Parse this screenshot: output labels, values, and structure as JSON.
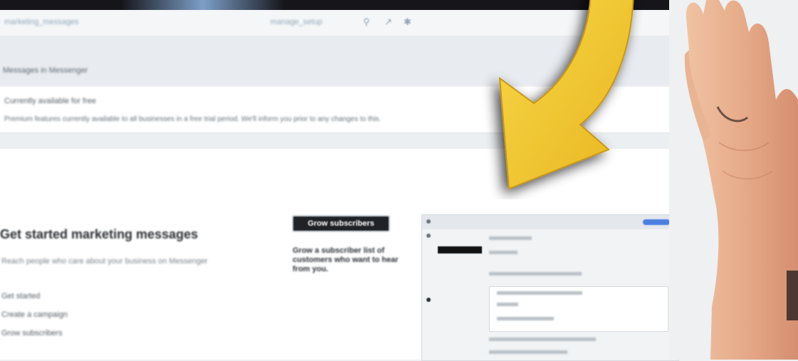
{
  "browser": {
    "address_text": "marketing_messages",
    "address_text_right": "manage_setup"
  },
  "page_header": {
    "title": "Messages in Messenger"
  },
  "notice": {
    "title": "Currently available for free",
    "body": "Premium features currently available to all businesses in a free trial period. We'll inform you prior to any changes to this."
  },
  "main": {
    "heading": "Get started marketing messages",
    "subtext": "Reach people who care about your business on Messenger",
    "list": [
      "Get started",
      "Create a campaign",
      "Grow subscribers"
    ]
  },
  "grow": {
    "button_label": "Grow subscribers",
    "description": "Grow a subscriber list of customers who want to hear from you."
  },
  "colors": {
    "arrow": "#f3c42a",
    "accent": "#4a7fe0"
  }
}
